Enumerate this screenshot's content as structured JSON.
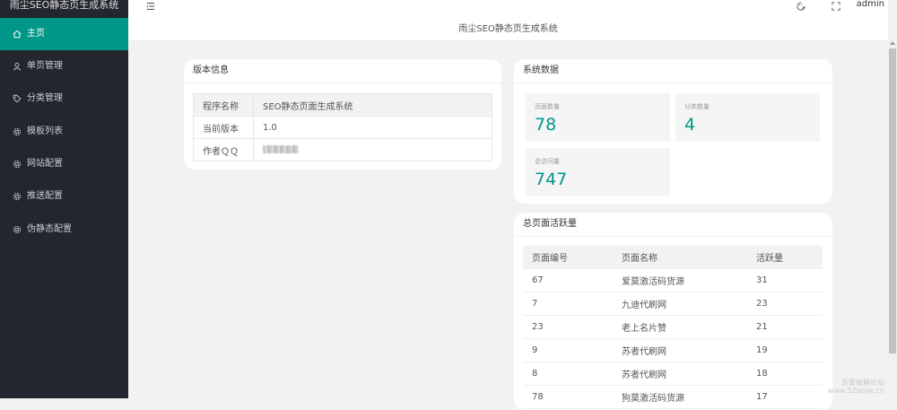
{
  "sidebar": {
    "logo": "雨尘SEO静态页生成系统",
    "items": [
      {
        "label": "主页",
        "icon": "home-icon",
        "active": true
      },
      {
        "label": "单页管理",
        "icon": "user-icon"
      },
      {
        "label": "分类管理",
        "icon": "tag-icon"
      },
      {
        "label": "模板列表",
        "icon": "gear-icon"
      },
      {
        "label": "网站配置",
        "icon": "gear-icon"
      },
      {
        "label": "推送配置",
        "icon": "gear-icon"
      },
      {
        "label": "伪静态配置",
        "icon": "gear-icon"
      }
    ]
  },
  "header": {
    "user": "admin",
    "icons": [
      "menu-toggle-icon",
      "theme-icon",
      "fullscreen-icon"
    ]
  },
  "page": {
    "title": "雨尘SEO静态页生成系统"
  },
  "version_card": {
    "title": "版本信息",
    "rows": [
      {
        "key": "程序名称",
        "value": "SEO静态页面生成系统"
      },
      {
        "key": "当前版本",
        "value": "1.0"
      },
      {
        "key": "作者ＱＱ",
        "value": ""
      }
    ]
  },
  "system_card": {
    "title": "系统数据",
    "stats": [
      {
        "label": "页面数量",
        "value": "78"
      },
      {
        "label": "分类数量",
        "value": "4"
      },
      {
        "label": "总访问量",
        "value": "747"
      }
    ]
  },
  "activity_card": {
    "title": "总页面活跃量",
    "columns": [
      "页面编号",
      "页面名称",
      "活跃量"
    ],
    "rows": [
      [
        "67",
        "爱莫激活码货源",
        "31"
      ],
      [
        "7",
        "九迪代刷网",
        "23"
      ],
      [
        "23",
        "老上名片赞",
        "21"
      ],
      [
        "9",
        "苏者代刷网",
        "19"
      ],
      [
        "8",
        "苏者代刷网",
        "18"
      ],
      [
        "78",
        "狗莫激活码货源",
        "17"
      ]
    ]
  },
  "watermark": {
    "line1": "吾爱破解论坛",
    "line2": "www.52pojie.cn"
  },
  "colors": {
    "accent": "#009688",
    "sidebar_bg": "#23262e",
    "page_bg": "#f2f2f2"
  }
}
